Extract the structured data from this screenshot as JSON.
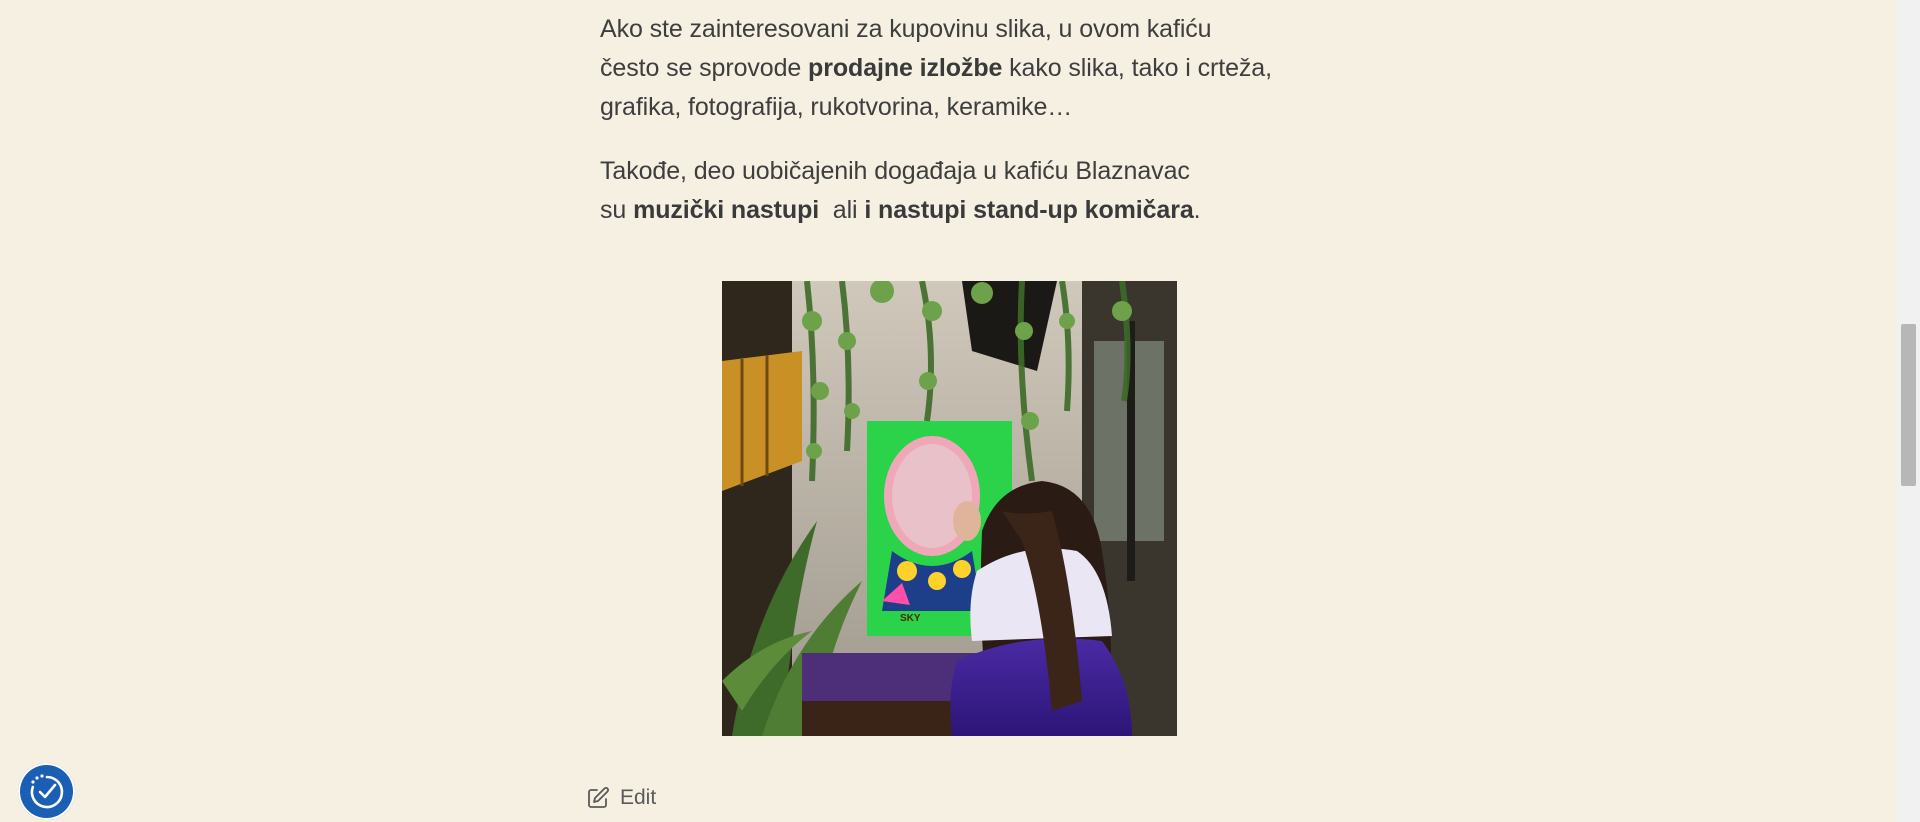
{
  "article": {
    "p1": {
      "line1": "Ako ste zainteresovani za kupovinu slika, u ovom kafiću",
      "line2_before": "često se sprovode ",
      "line2_bold": "prodajne izložbe",
      "line2_after": " kako slika, tako i crteža,",
      "line3": "grafika, fotografija, rukotvorina, keramike…"
    },
    "p2": {
      "line1": "Takođe, deo uobičajenih događaja u kafiću Blaznavac",
      "line2_before": "su ",
      "line2_bold1": "muzički nastupi",
      "line2_mid": "  ali ",
      "line2_bold2": "i nastupi stand-up komičara",
      "line2_end": "."
    }
  },
  "image": {
    "alt": "",
    "icon": "photo-cafe-interior"
  },
  "edit": {
    "label": "Edit",
    "icon": "edit-icon"
  },
  "accessibility": {
    "icon": "accessibility-check-icon",
    "color": "#1b5fb4"
  },
  "theme": {
    "background": "#f5f0e1",
    "text": "#3e3e3e"
  }
}
